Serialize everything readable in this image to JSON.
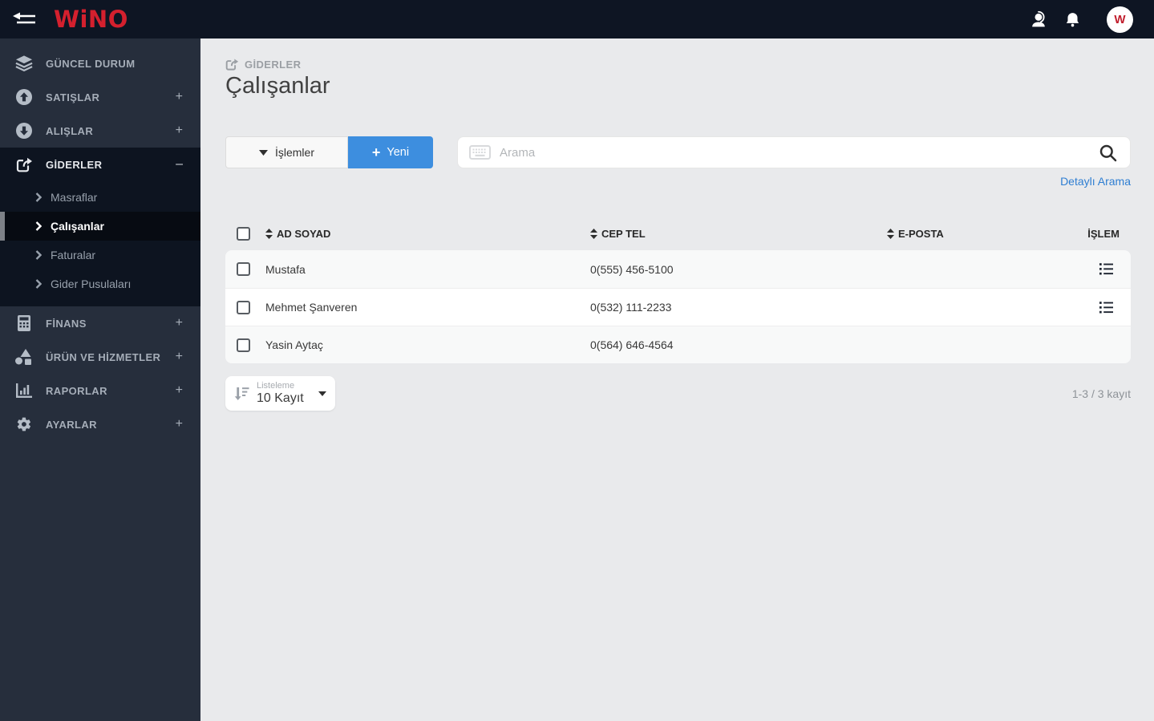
{
  "topbar": {
    "logo_text": "WiNO",
    "avatar_text": "W"
  },
  "icons": {
    "collapse-menu-icon": "left-arrow-with-lines",
    "support-icon": "headset-person",
    "notifications-icon": "bell",
    "layers-icon": "stacked-layers",
    "sales-icon": "arrow-up-circle",
    "purchases-icon": "arrow-down-circle",
    "expenses-icon": "share-square",
    "finance-icon": "calculator",
    "products-icon": "shapes",
    "reports-icon": "bar-chart",
    "settings-icon": "gear",
    "keyboard-icon": "keyboard",
    "search-icon": "magnifier",
    "sort-icon": "up-down-triangles",
    "row-actions-icon": "bulleted-list",
    "listing-icon": "sort-amount-down",
    "caret-down-icon": "triangle-down",
    "plus-icon": "+",
    "chevron-right-icon": "❯"
  },
  "sidebar": {
    "items": [
      {
        "label": "GÜNCEL DURUM",
        "expander": ""
      },
      {
        "label": "SATIŞLAR",
        "expander": "+"
      },
      {
        "label": "ALIŞLAR",
        "expander": "+"
      },
      {
        "label": "GİDERLER",
        "expander": "–"
      },
      {
        "label": "FİNANS",
        "expander": "+"
      },
      {
        "label": "ÜRÜN VE HİZMETLER",
        "expander": "+"
      },
      {
        "label": "RAPORLAR",
        "expander": "+"
      },
      {
        "label": "AYARLAR",
        "expander": "+"
      }
    ],
    "giderler_children": [
      {
        "label": "Masraflar"
      },
      {
        "label": "Çalışanlar"
      },
      {
        "label": "Faturalar"
      },
      {
        "label": "Gider Pusulaları"
      }
    ]
  },
  "page": {
    "breadcrumb": "GİDERLER",
    "title": "Çalışanlar"
  },
  "toolbar": {
    "islemler": "İşlemler",
    "yeni": "Yeni",
    "search_placeholder": "Arama",
    "detayli_arama": "Detaylı Arama"
  },
  "table": {
    "headers": {
      "ad_soyad": "AD SOYAD",
      "cep_tel": "CEP TEL",
      "e_posta": "E-POSTA",
      "islem": "İŞLEM"
    },
    "rows": [
      {
        "name": "Mustafa",
        "phone": "0(555) 456-5100",
        "email": ""
      },
      {
        "name": "Mehmet Şanveren",
        "phone": "0(532) 111-2233",
        "email": ""
      },
      {
        "name": "Yasin Aytaç",
        "phone": "0(564) 646-4564",
        "email": ""
      }
    ]
  },
  "pagination": {
    "listeleme": "Listeleme",
    "page_size": "10 Kayıt",
    "range": "1-3 / 3 kayıt"
  },
  "colors": {
    "topbar_bg": "#0e1523",
    "sidebar_bg": "#262e3c",
    "accent_blue": "#3d8edf",
    "link_blue": "#2e7ed2",
    "logo_red": "#d4202e",
    "content_bg": "#e9eaec"
  }
}
